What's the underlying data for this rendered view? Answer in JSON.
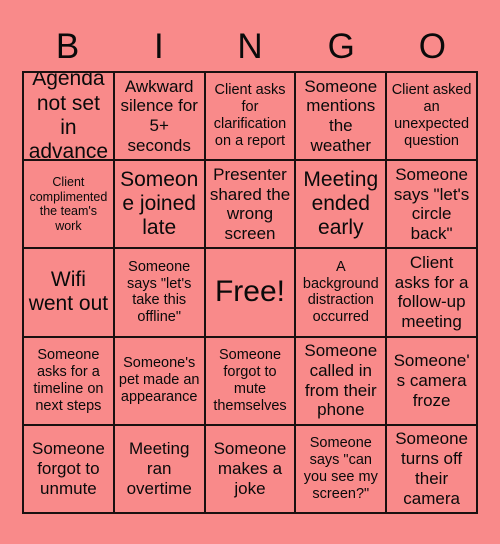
{
  "card": {
    "title_letters": [
      "B",
      "I",
      "N",
      "G",
      "O"
    ],
    "background_color": "#f98a8a",
    "cell_fill_color": "#f98a8a",
    "border_color": "#1a1010",
    "text_color": "#0a0a0a",
    "columns": 5,
    "rows": 5,
    "free_space": "Free!",
    "free_space_position": {
      "row": 3,
      "column": 3
    }
  },
  "cells": [
    {
      "text": "Agenda not set in advance",
      "size": "lg"
    },
    {
      "text": "Awkward silence for 5+ seconds",
      "size": "md"
    },
    {
      "text": "Client asks for clarification on a report",
      "size": "sm"
    },
    {
      "text": "Someone mentions the weather",
      "size": "md"
    },
    {
      "text": "Client asked an unexpected question",
      "size": "sm"
    },
    {
      "text": "Client complimented the team's work",
      "size": "xs"
    },
    {
      "text": "Someone joined late",
      "size": "lg"
    },
    {
      "text": "Presenter shared the wrong screen",
      "size": "md"
    },
    {
      "text": "Meeting ended early",
      "size": "lg"
    },
    {
      "text": "Someone says \"let's circle back\"",
      "size": "md"
    },
    {
      "text": "Wifi went out",
      "size": "lg"
    },
    {
      "text": "Someone says \"let's take this offline\"",
      "size": "sm"
    },
    {
      "text": "Free!",
      "size": "xl"
    },
    {
      "text": "A background distraction occurred",
      "size": "sm"
    },
    {
      "text": "Client asks for a follow-up meeting",
      "size": "md"
    },
    {
      "text": "Someone asks for a timeline on next steps",
      "size": "sm"
    },
    {
      "text": "Someone's pet made an appearance",
      "size": "sm"
    },
    {
      "text": "Someone forgot to mute themselves",
      "size": "sm"
    },
    {
      "text": "Someone called in from their phone",
      "size": "md"
    },
    {
      "text": "Someone's camera froze",
      "size": "md"
    },
    {
      "text": "Someone forgot to unmute",
      "size": "md"
    },
    {
      "text": "Meeting ran overtime",
      "size": "md"
    },
    {
      "text": "Someone makes a joke",
      "size": "md"
    },
    {
      "text": "Someone says \"can you see my screen?\"",
      "size": "sm"
    },
    {
      "text": "Someone turns off their camera",
      "size": "md"
    }
  ]
}
